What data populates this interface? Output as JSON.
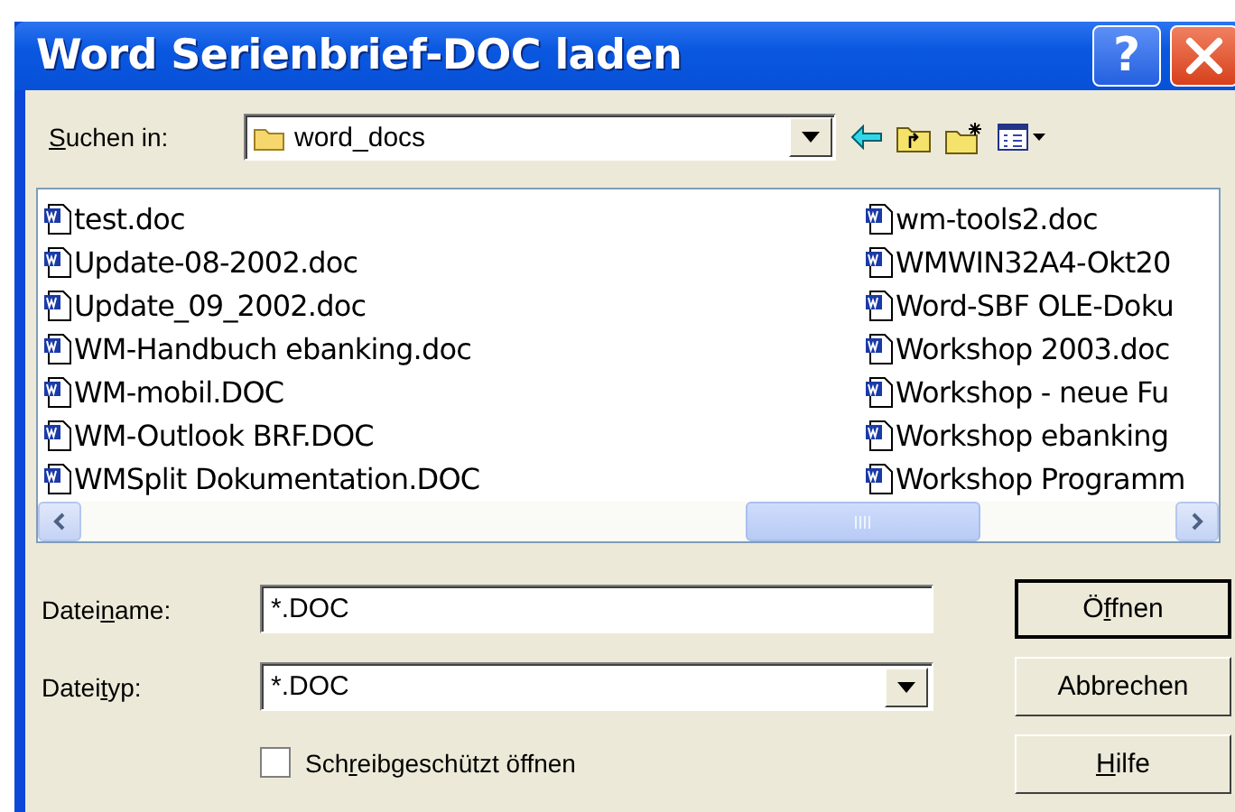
{
  "window": {
    "title": "Word Serienbrief-DOC laden",
    "help_button": "?"
  },
  "look_in": {
    "label": {
      "key": "S",
      "post": "uchen in:"
    },
    "value": "word_docs"
  },
  "file_columns": [
    {
      "files": [
        "test.doc",
        "Update-08-2002.doc",
        "Update_09_2002.doc",
        "WM-Handbuch ebanking.doc",
        "WM-mobil.DOC",
        "WM-Outlook BRF.DOC",
        "WMSplit Dokumentation.DOC"
      ]
    },
    {
      "files": [
        "wm-tools2.doc",
        "WMWIN32A4-Okt20",
        "Word-SBF OLE-Doku",
        "Workshop 2003.doc",
        "Workshop - neue Fu",
        "Workshop ebanking",
        "Workshop Programm"
      ]
    }
  ],
  "filename": {
    "label": {
      "pre": "Datei",
      "key": "n",
      "post": "ame:"
    },
    "value": "*.DOC"
  },
  "filetype": {
    "label": {
      "pre": "Datei",
      "key": "t",
      "post": "yp:"
    },
    "value": "*.DOC"
  },
  "read_only": {
    "label": {
      "pre": "Sch",
      "key": "r",
      "post": "eibgeschützt öffnen"
    },
    "checked": false
  },
  "buttons": [
    {
      "label": {
        "pre": "Ö",
        "key": "f",
        "post": "fnen"
      },
      "default": true
    },
    {
      "label": {
        "pre": "Abbrechen"
      },
      "default": false
    },
    {
      "label": {
        "key": "H",
        "post": "ilfe"
      },
      "default": false
    }
  ]
}
